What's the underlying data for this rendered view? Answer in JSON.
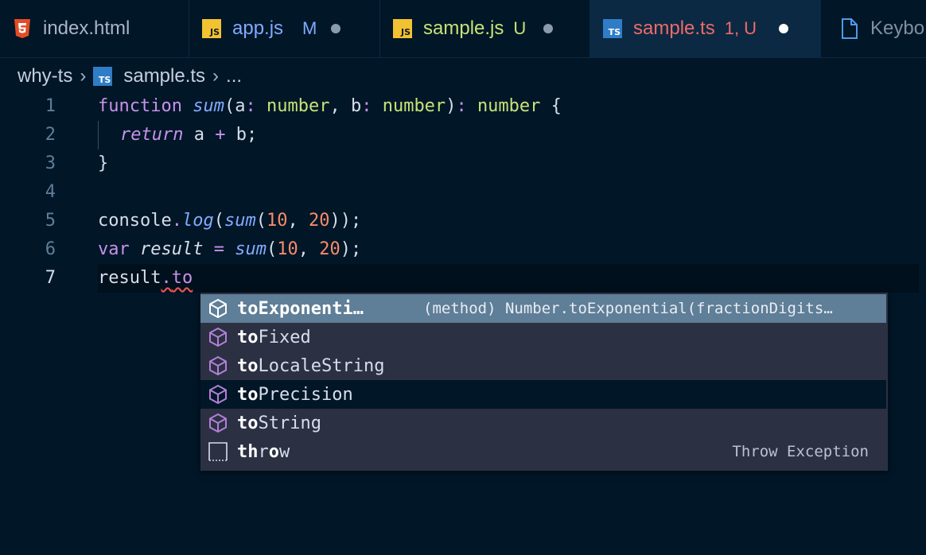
{
  "tabs": [
    {
      "label": "index.html",
      "status": "",
      "icon": "html5-icon",
      "color": "#a9b5c6"
    },
    {
      "label": "app.js",
      "status": "M",
      "icon": "javascript-icon",
      "color": "#82aaff"
    },
    {
      "label": "sample.js",
      "status": "U",
      "icon": "javascript-icon",
      "color": "#c5e478"
    },
    {
      "label": "sample.ts",
      "status": "1, U",
      "icon": "typescript-icon",
      "color": "#ef6a6a"
    },
    {
      "label": "Keybo",
      "status": "",
      "icon": "file-icon",
      "color": "#7f8fa4"
    }
  ],
  "file_badges": {
    "js": "JS",
    "ts": "TS"
  },
  "breadcrumb": {
    "folder": "why-ts",
    "file": "sample.ts",
    "more": "...",
    "sep": "›"
  },
  "lines": [
    {
      "num": "1"
    },
    {
      "num": "2"
    },
    {
      "num": "3"
    },
    {
      "num": "4"
    },
    {
      "num": "5"
    },
    {
      "num": "6"
    },
    {
      "num": "7"
    }
  ],
  "code": {
    "l1": {
      "kw": "function",
      "fname": "sum",
      "p1": "a",
      "t1": "number",
      "p2": "b",
      "t2": "number",
      "ret": "number"
    },
    "l2": {
      "kw": "return",
      "a": "a",
      "op": "+",
      "b": "b;"
    },
    "l5": {
      "obj": "console",
      "method": "log",
      "fname": "sum",
      "n1": "10",
      "n2": "20",
      "end": "));"
    },
    "l6": {
      "kw": "var",
      "name": "result",
      "op": "=",
      "fname": "sum",
      "n1": "10",
      "n2": "20",
      "end": ");"
    },
    "l7": {
      "obj": "result",
      "typed": "to"
    }
  },
  "suggestions": [
    {
      "match": "to",
      "rest": "Exponenti…",
      "detail": "(method) Number.toExponential(fractionDigits…",
      "icon": "method-cube-icon"
    },
    {
      "match": "to",
      "rest": "Fixed",
      "detail": "",
      "icon": "method-cube-icon"
    },
    {
      "match": "to",
      "rest": "LocaleString",
      "detail": "",
      "icon": "method-cube-icon"
    },
    {
      "match": "to",
      "rest": "Precision",
      "detail": "",
      "icon": "method-cube-icon"
    },
    {
      "match": "to",
      "rest": "String",
      "detail": "",
      "icon": "method-cube-icon"
    },
    {
      "match": "th",
      "rest": "r",
      "match2": "o",
      "rest2": "w",
      "detail": "Throw Exception",
      "icon": "snippet-icon"
    }
  ],
  "colors": {
    "background": "#011627",
    "keyword": "#c792ea",
    "function": "#82aaff",
    "type": "#c5e478",
    "number": "#f78c6c",
    "error_squiggle": "#ef5350"
  }
}
